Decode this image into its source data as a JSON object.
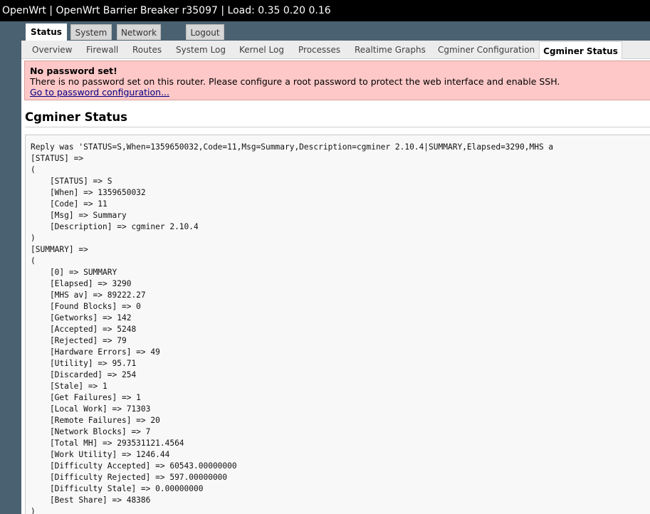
{
  "header": {
    "title": "OpenWrt | OpenWrt Barrier Breaker r35097 | Load: 0.35 0.20 0.16"
  },
  "main_tabs": [
    {
      "label": "Status",
      "active": true
    },
    {
      "label": "System",
      "active": false
    },
    {
      "label": "Network",
      "active": false
    },
    {
      "label": "Logout",
      "active": false
    }
  ],
  "sub_tabs": [
    {
      "label": "Overview",
      "active": false
    },
    {
      "label": "Firewall",
      "active": false
    },
    {
      "label": "Routes",
      "active": false
    },
    {
      "label": "System Log",
      "active": false
    },
    {
      "label": "Kernel Log",
      "active": false
    },
    {
      "label": "Processes",
      "active": false
    },
    {
      "label": "Realtime Graphs",
      "active": false
    },
    {
      "label": "Cgminer Configuration",
      "active": false
    },
    {
      "label": "Cgminer Status",
      "active": true
    }
  ],
  "alert": {
    "title": "No password set!",
    "message": "There is no password set on this router. Please configure a root password to protect the web interface and enable SSH.",
    "link": "Go to password configuration..."
  },
  "page": {
    "title": "Cgminer Status"
  },
  "output": {
    "reply_line": "Reply was 'STATUS=S,When=1359650032,Code=11,Msg=Summary,Description=cgminer 2.10.4|SUMMARY,Elapsed=3290,MHS a",
    "lines": [
      "[STATUS] =>",
      "(",
      "    [STATUS] => S",
      "    [When] => 1359650032",
      "    [Code] => 11",
      "    [Msg] => Summary",
      "    [Description] => cgminer 2.10.4",
      ")",
      "[SUMMARY] =>",
      "(",
      "    [0] => SUMMARY",
      "    [Elapsed] => 3290",
      "    [MHS av] => 89222.27",
      "    [Found Blocks] => 0",
      "    [Getworks] => 142",
      "    [Accepted] => 5248",
      "    [Rejected] => 79",
      "    [Hardware Errors] => 49",
      "    [Utility] => 95.71",
      "    [Discarded] => 254",
      "    [Stale] => 1",
      "    [Get Failures] => 1",
      "    [Local Work] => 71303",
      "    [Remote Failures] => 20",
      "    [Network Blocks] => 7",
      "    [Total MH] => 293531121.4564",
      "    [Work Utility] => 1246.44",
      "    [Difficulty Accepted] => 60543.00000000",
      "    [Difficulty Rejected] => 597.00000000",
      "    [Difficulty Stale] => 0.00000000",
      "    [Best Share] => 48386",
      ")"
    ]
  },
  "colors": {
    "header_bg": "#000000",
    "side_bg": "#4a6171",
    "alert_bg": "#ffc8c8",
    "link": "#000080"
  }
}
